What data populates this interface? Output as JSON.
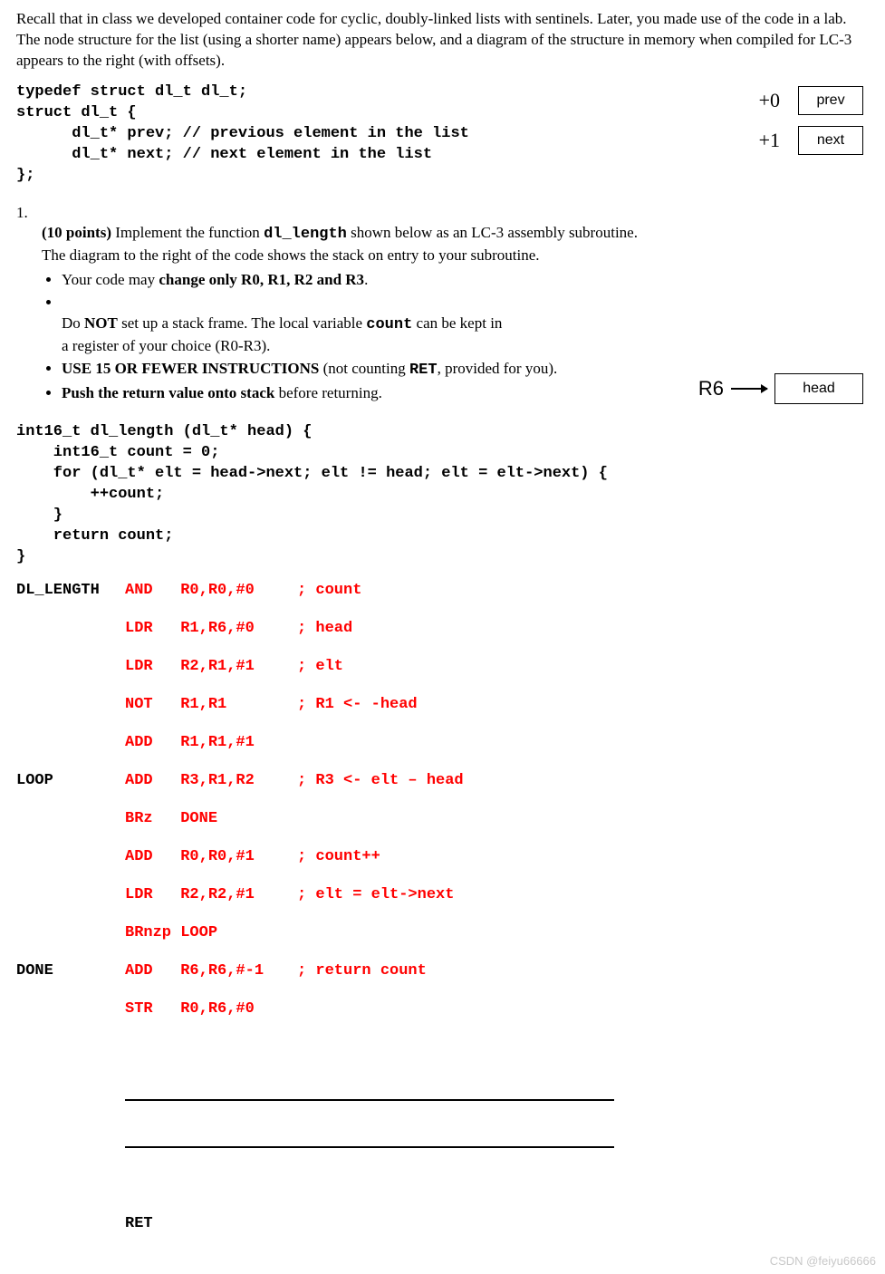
{
  "intro": "Recall that in class we developed container code for cyclic, doubly-linked lists with sentinels.  Later, you made use of the code in a lab.  The node structure for the list (using a shorter name) appears below, and a diagram of the structure in memory when compiled for LC-3 appears to the right (with offsets).",
  "struct_code": "typedef struct dl_t dl_t;\nstruct dl_t {\n      dl_t* prev; // previous element in the list\n      dl_t* next; // next element in the list\n};",
  "diagram_top": {
    "rows": [
      {
        "offset": "+0",
        "field": "prev"
      },
      {
        "offset": "+1",
        "field": "next"
      }
    ]
  },
  "q1": {
    "number": "1.",
    "points": "(10 points)",
    "lead_a": " Implement the function ",
    "fn_name": "dl_length",
    "lead_b": " shown below as an LC-3 assembly subroutine.\nThe diagram to the right of the code shows the stack on entry to your subroutine.",
    "bullets": [
      {
        "pre": "Your code may ",
        "bold": "change only R0, R1, R2 and R3",
        "post": "."
      },
      {
        "pre": "Do ",
        "bold": "NOT",
        "post": " set up a stack frame.  The local variable ",
        "mono": "count",
        "post2": " can be kept in\na register of your choice (R0-R3)."
      },
      {
        "pre": "",
        "bold": "USE 15 OR FEWER INSTRUCTIONS",
        "post": " (not counting ",
        "mono": "RET",
        "post2": ", provided for you)."
      },
      {
        "pre": "",
        "bold": "Push the return value onto stack",
        "post": " before returning."
      }
    ]
  },
  "stack_diag": {
    "reg": "R6",
    "cell": "head"
  },
  "c_code": "int16_t dl_length (dl_t* head) {\n    int16_t count = 0;\n    for (dl_t* elt = head->next; elt != head; elt = elt->next) {\n        ++count;\n    }\n    return count;\n}",
  "asm": [
    {
      "label": "DL_LENGTH",
      "instr": "AND   R0,R0,#0",
      "comment": "; count"
    },
    {
      "label": "",
      "instr": "LDR   R1,R6,#0",
      "comment": "; head"
    },
    {
      "label": "",
      "instr": "LDR   R2,R1,#1",
      "comment": "; elt"
    },
    {
      "label": "",
      "instr": "NOT   R1,R1",
      "comment": "; R1 <- -head"
    },
    {
      "label": "",
      "instr": "ADD   R1,R1,#1",
      "comment": ""
    },
    {
      "label": "LOOP",
      "instr": "ADD   R3,R1,R2",
      "comment": "; R3 <- elt – head"
    },
    {
      "label": "",
      "instr": "BRz   DONE",
      "comment": ""
    },
    {
      "label": "",
      "instr": "ADD   R0,R0,#1",
      "comment": "; count++"
    },
    {
      "label": "",
      "instr": "LDR   R2,R2,#1",
      "comment": "; elt = elt->next"
    },
    {
      "label": "",
      "instr": "BRnzp LOOP",
      "comment": ""
    },
    {
      "label": "DONE",
      "instr": "ADD   R6,R6,#-1",
      "comment": "; return count"
    },
    {
      "label": "",
      "instr": "STR   R0,R6,#0",
      "comment": "",
      "tall": true
    }
  ],
  "ret_label": "RET",
  "watermark": "CSDN @feiyu66666"
}
